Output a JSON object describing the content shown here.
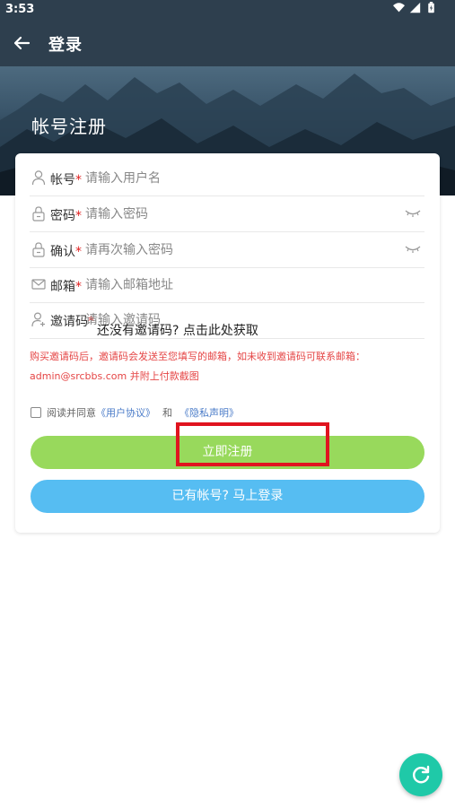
{
  "status_bar": {
    "time": "3:53"
  },
  "app_bar": {
    "title": "登录"
  },
  "hero": {
    "title": "帐号注册"
  },
  "form": {
    "username": {
      "label": "帐号",
      "required_mark": "*",
      "placeholder": "请输入用户名"
    },
    "password": {
      "label": "密码",
      "required_mark": "*",
      "placeholder": "请输入密码"
    },
    "confirm": {
      "label": "确认",
      "required_mark": "*",
      "placeholder": "请再次输入密码"
    },
    "email": {
      "label": "邮箱",
      "required_mark": "*",
      "placeholder": "请输入邮箱地址"
    },
    "invite": {
      "label": "邀请码",
      "required_mark": "*",
      "placeholder": "请输入邀请码",
      "link": "还没有邀请码? 点击此处获取"
    }
  },
  "notice": {
    "line1": "购买邀请码后，邀请码会发送至您填写的邮箱，如未收到邀请码可联系邮箱：",
    "line2": "admin@srcbbs.com 并附上付款截图"
  },
  "agreement": {
    "prefix": "阅读并同意",
    "terms": "《用户协议》",
    "and": "和",
    "privacy": "《隐私声明》"
  },
  "buttons": {
    "register": "立即注册",
    "login": "已有帐号? 马上登录"
  },
  "colors": {
    "app_bar": "#2e3f4e",
    "register": "#98d95c",
    "login": "#56bdf2",
    "highlight": "#e0141f",
    "fab": "#1fc9a8"
  },
  "icons": [
    "wifi-icon",
    "signal-icon",
    "battery-icon",
    "back-arrow-icon",
    "user-icon",
    "lock-icon",
    "mail-icon",
    "add-user-icon",
    "eye-closed-icon",
    "refresh-icon"
  ]
}
